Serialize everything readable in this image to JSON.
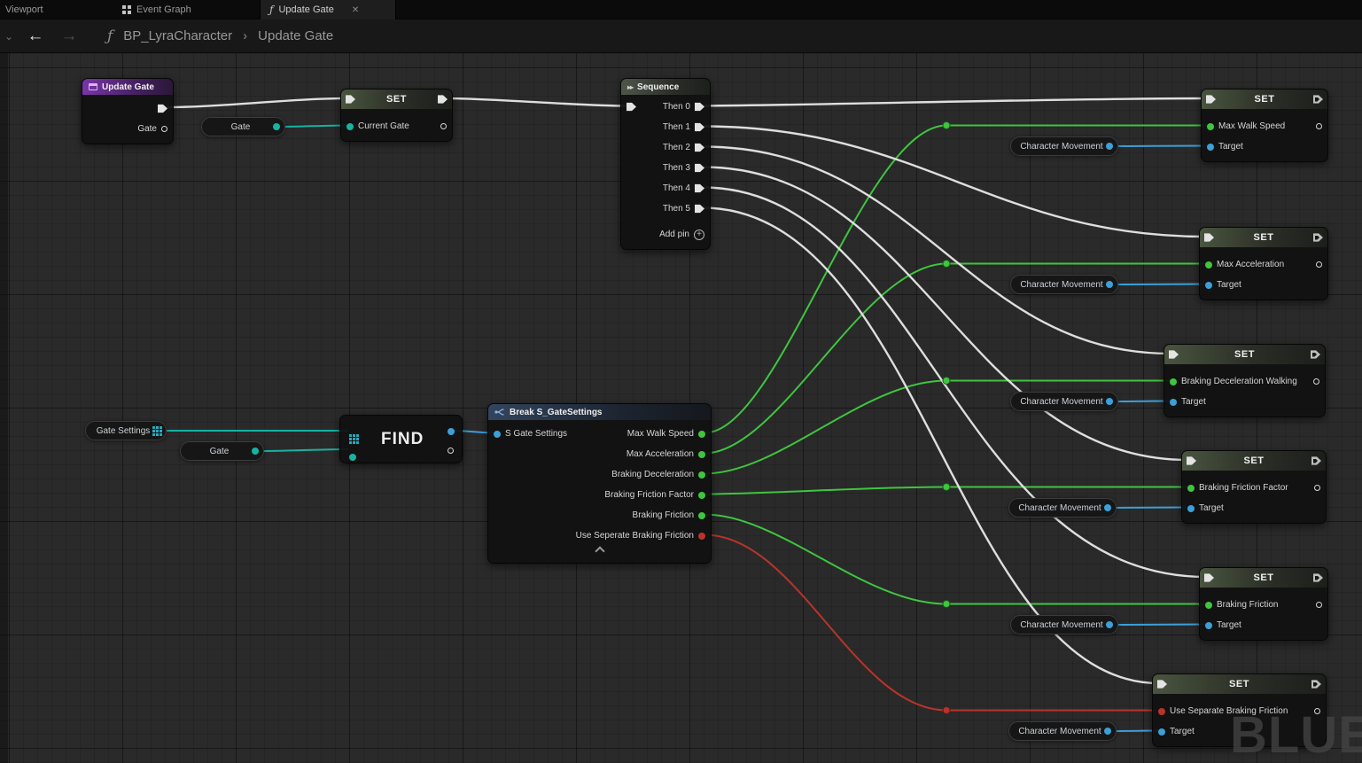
{
  "tab_bar": {
    "viewport": "Viewport",
    "event_graph": "Event Graph",
    "update_gate": "Update Gate"
  },
  "breadcrumb": {
    "blueprint": "BP_LyraCharacter",
    "page": "Update Gate"
  },
  "icons": {
    "function": "ƒ",
    "separator": "›",
    "back": "←",
    "forward": "→",
    "collapse": "⌄",
    "close": "✕",
    "sequence": "▸▸",
    "plus": "+"
  },
  "graph": {
    "update_gate_node": {
      "title": "Update Gate",
      "gate_pin": "Gate"
    },
    "gate_var_1": "Gate",
    "set_current_gate": {
      "title": "SET",
      "pin": "Current Gate"
    },
    "sequence": {
      "title": "Sequence",
      "then_pins": [
        "Then 0",
        "Then 1",
        "Then 2",
        "Then 3",
        "Then 4",
        "Then 5"
      ],
      "add_pin": "Add pin"
    },
    "gate_settings_var": "Gate Settings",
    "gate_var_2": "Gate",
    "find_node": {
      "title": "FIND"
    },
    "break_node": {
      "title": "Break S_GateSettings",
      "input_pin": "S Gate Settings",
      "output_pins": [
        "Max Walk Speed",
        "Max Acceleration",
        "Braking Deceleration",
        "Braking Friction Factor",
        "Braking Friction",
        "Use Seperate Braking Friction"
      ]
    },
    "character_movement_var": "Character Movement",
    "set_nodes": [
      {
        "title": "SET",
        "value_pin": "Max Walk Speed",
        "target_pin": "Target"
      },
      {
        "title": "SET",
        "value_pin": "Max Acceleration",
        "target_pin": "Target"
      },
      {
        "title": "SET",
        "value_pin": "Braking Deceleration Walking",
        "target_pin": "Target"
      },
      {
        "title": "SET",
        "value_pin": "Braking Friction Factor",
        "target_pin": "Target"
      },
      {
        "title": "SET",
        "value_pin": "Braking Friction",
        "target_pin": "Target"
      },
      {
        "title": "SET",
        "value_pin": "Use Separate Braking Friction",
        "target_pin": "Target"
      }
    ]
  },
  "watermark": "BLUEPRINT",
  "colors": {
    "exec_wire": "#dedede",
    "float_pin": "#3fc53f",
    "bool_pin": "#b8342a",
    "object_pin": "#3c9fd8",
    "struct_pin": "#18b2a2",
    "event_header": "#7a35a8"
  }
}
